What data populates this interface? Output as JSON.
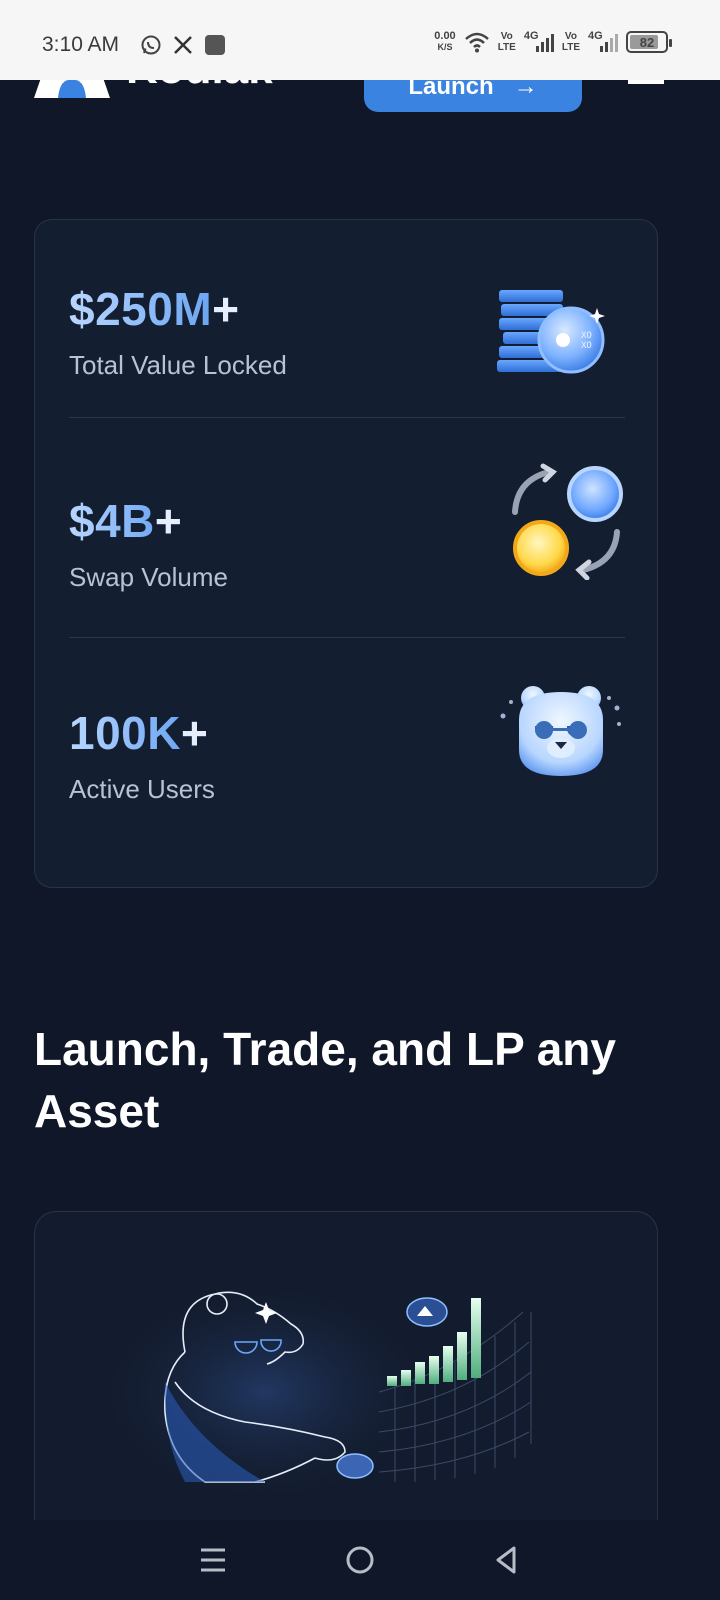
{
  "status_bar": {
    "time": "3:10 AM",
    "net_speed_value": "0.00",
    "net_speed_unit": "K/S",
    "sim1_label_top": "Vo",
    "sim1_label_bottom": "LTE",
    "sim1_network": "4G",
    "sim2_label_top": "Vo",
    "sim2_label_bottom": "LTE",
    "sim2_network": "4G",
    "battery_level": "82",
    "battery_fraction": 0.82,
    "icons": [
      "whatsapp-icon",
      "x-icon",
      "app-notification-icon",
      "wifi-icon",
      "signal-icon",
      "battery-icon"
    ]
  },
  "header": {
    "logo_text": "Kodiak",
    "launch_label": "Launch",
    "launch_arrow": "→"
  },
  "stats": [
    {
      "value": "$250M",
      "suffix": "+",
      "label": "Total Value Locked",
      "icon": "coin-stack-icon"
    },
    {
      "value": "$4B",
      "suffix": "+",
      "label": "Swap Volume",
      "icon": "swap-coins-icon"
    },
    {
      "value": "100K",
      "suffix": "+",
      "label": "Active Users",
      "icon": "bear-avatar-icon"
    }
  ],
  "section_title": "Launch, Trade, and LP any Asset",
  "feature_card": {
    "illustration": "bear-trading-illustration"
  },
  "nav_bar": {
    "items": [
      "menu-icon",
      "home-icon",
      "back-icon"
    ]
  },
  "colors": {
    "background": "#0f1729",
    "card": "#141e31",
    "accent": "#3a83e0",
    "stat_gradient_start": "#b9d6ff",
    "stat_gradient_end": "#5b9bf0",
    "label": "#b9c2d4"
  }
}
